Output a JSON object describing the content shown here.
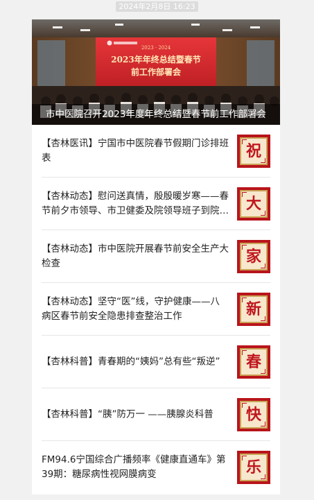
{
  "timestamp": "2024年2月8日 16:23",
  "hero": {
    "banner_line1": "2023年年终总结暨春节",
    "banner_line2": "前工作部署会",
    "banner_tag": "2023 · 2024",
    "caption": "市中医院召开2023年度年终总结暨春节前工作部署会"
  },
  "articles": [
    {
      "title": "【杏林医讯】宁国市中医院春节假期门诊排班表",
      "thumb_char": "祝"
    },
    {
      "title": "【杏林动态】慰问送真情，殷殷暖岁寒——春节前夕市领导、市卫健委及院领导班子到院慰问",
      "thumb_char": "大"
    },
    {
      "title": "【杏林动态】市中医院开展春节前安全生产大检查",
      "thumb_char": "家"
    },
    {
      "title": "【杏林动态】坚守“医”线，守护健康——八病区春节前安全隐患排查整治工作",
      "thumb_char": "新"
    },
    {
      "title": "【杏林科普】青春期的“姨妈”总有些“叛逆”",
      "thumb_char": "春"
    },
    {
      "title": "【杏林科普】“胰”防万一 ——胰腺炎科普",
      "thumb_char": "快"
    },
    {
      "title": "FM94.6宁国综合广播频率《健康直通车》第39期：糖尿病性视网膜病变",
      "thumb_char": "乐"
    }
  ],
  "colors": {
    "accent_red": "#b8141b",
    "thumb_bg": "#f7e7cc",
    "page_bg": "#f1f1f1"
  }
}
